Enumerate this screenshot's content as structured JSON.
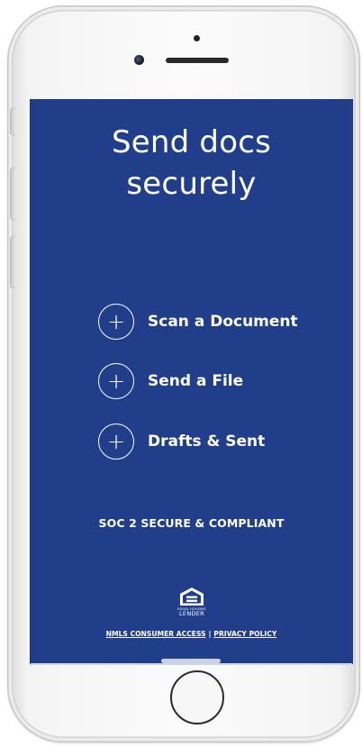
{
  "screen": {
    "title_line1": "Send docs",
    "title_line2": "securely",
    "menu": [
      {
        "icon": "plus-icon",
        "label": "Scan a Document"
      },
      {
        "icon": "plus-icon",
        "label": "Send a File"
      },
      {
        "icon": "plus-icon",
        "label": "Drafts & Sent"
      }
    ],
    "badge_text": "SOC 2 SECURE & COMPLIANT",
    "ehl_logo": {
      "small_text": "EQUAL HOUSING",
      "big_text": "LENDER"
    },
    "footer": {
      "nmls_link": "NMLS CONSUMER ACCESS",
      "separator": "|",
      "privacy_link": "PRIVACY POLICY"
    }
  },
  "colors": {
    "background": "#213e8a",
    "text": "#ffffff"
  }
}
